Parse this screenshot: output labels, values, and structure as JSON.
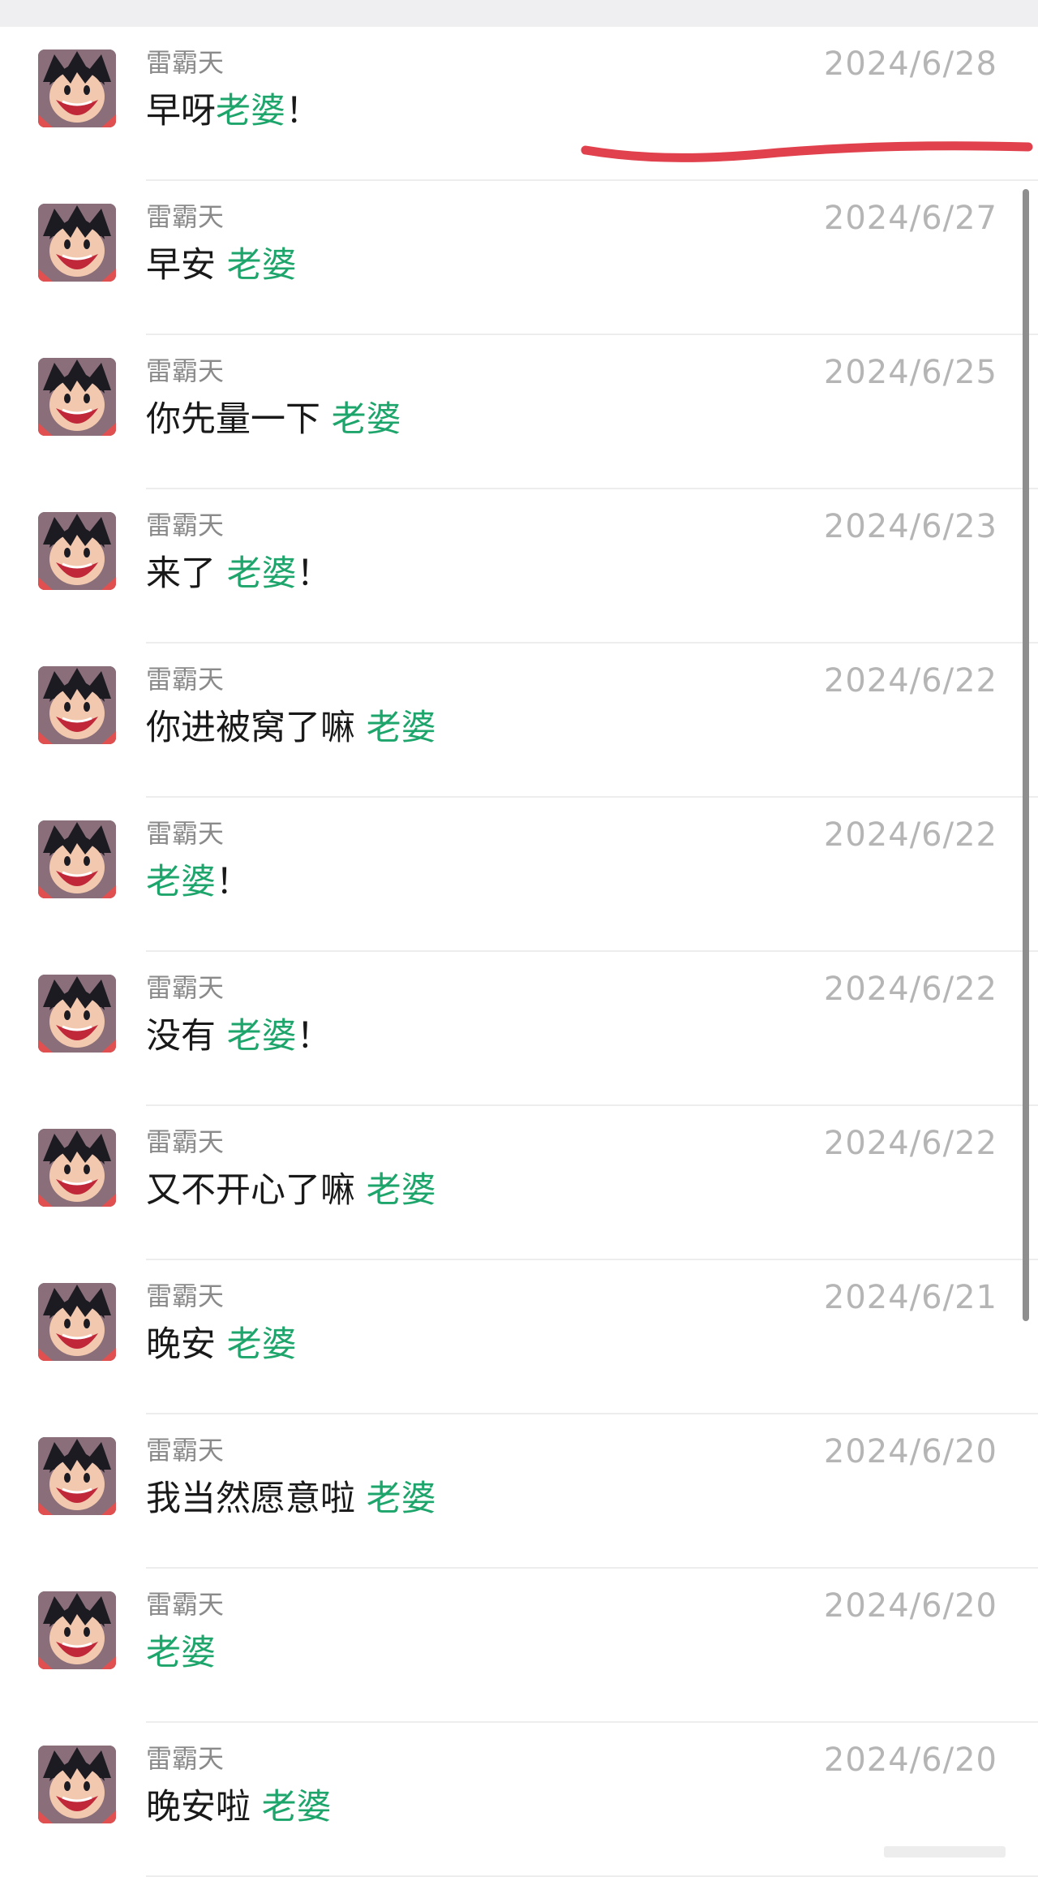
{
  "colors": {
    "keyword_highlight": "#1ea56c",
    "sender_text": "#8a8a8a",
    "date_text": "#b5b5b5",
    "message_text": "#191919",
    "annotation_stroke": "#e0414c",
    "scrollbar": "#8e8e8e"
  },
  "search": {
    "highlight_keyword": "老婆"
  },
  "results": [
    {
      "sender": "雷霸天",
      "date": "2024/6/28",
      "message": [
        {
          "text": "早呀",
          "hl": false
        },
        {
          "text": "老婆",
          "hl": true
        },
        {
          "text": "！",
          "hl": false
        }
      ]
    },
    {
      "sender": "雷霸天",
      "date": "2024/6/27",
      "message": [
        {
          "text": "早安 ",
          "hl": false
        },
        {
          "text": "老婆",
          "hl": true
        }
      ]
    },
    {
      "sender": "雷霸天",
      "date": "2024/6/25",
      "message": [
        {
          "text": "你先量一下 ",
          "hl": false
        },
        {
          "text": "老婆",
          "hl": true
        }
      ]
    },
    {
      "sender": "雷霸天",
      "date": "2024/6/23",
      "message": [
        {
          "text": "来了 ",
          "hl": false
        },
        {
          "text": "老婆",
          "hl": true
        },
        {
          "text": "！",
          "hl": false
        }
      ]
    },
    {
      "sender": "雷霸天",
      "date": "2024/6/22",
      "message": [
        {
          "text": "你进被窝了嘛 ",
          "hl": false
        },
        {
          "text": "老婆",
          "hl": true
        }
      ]
    },
    {
      "sender": "雷霸天",
      "date": "2024/6/22",
      "message": [
        {
          "text": "老婆",
          "hl": true
        },
        {
          "text": "！",
          "hl": false
        }
      ]
    },
    {
      "sender": "雷霸天",
      "date": "2024/6/22",
      "message": [
        {
          "text": "没有 ",
          "hl": false
        },
        {
          "text": "老婆",
          "hl": true
        },
        {
          "text": "！",
          "hl": false
        }
      ]
    },
    {
      "sender": "雷霸天",
      "date": "2024/6/22",
      "message": [
        {
          "text": "又不开心了嘛 ",
          "hl": false
        },
        {
          "text": "老婆",
          "hl": true
        }
      ]
    },
    {
      "sender": "雷霸天",
      "date": "2024/6/21",
      "message": [
        {
          "text": "晚安 ",
          "hl": false
        },
        {
          "text": "老婆",
          "hl": true
        }
      ]
    },
    {
      "sender": "雷霸天",
      "date": "2024/6/20",
      "message": [
        {
          "text": "我当然愿意啦 ",
          "hl": false
        },
        {
          "text": "老婆",
          "hl": true
        }
      ]
    },
    {
      "sender": "雷霸天",
      "date": "2024/6/20",
      "message": [
        {
          "text": "老婆",
          "hl": true
        }
      ]
    },
    {
      "sender": "雷霸天",
      "date": "2024/6/20",
      "message": [
        {
          "text": "晚安啦 ",
          "hl": false
        },
        {
          "text": "老婆",
          "hl": true
        }
      ]
    }
  ]
}
